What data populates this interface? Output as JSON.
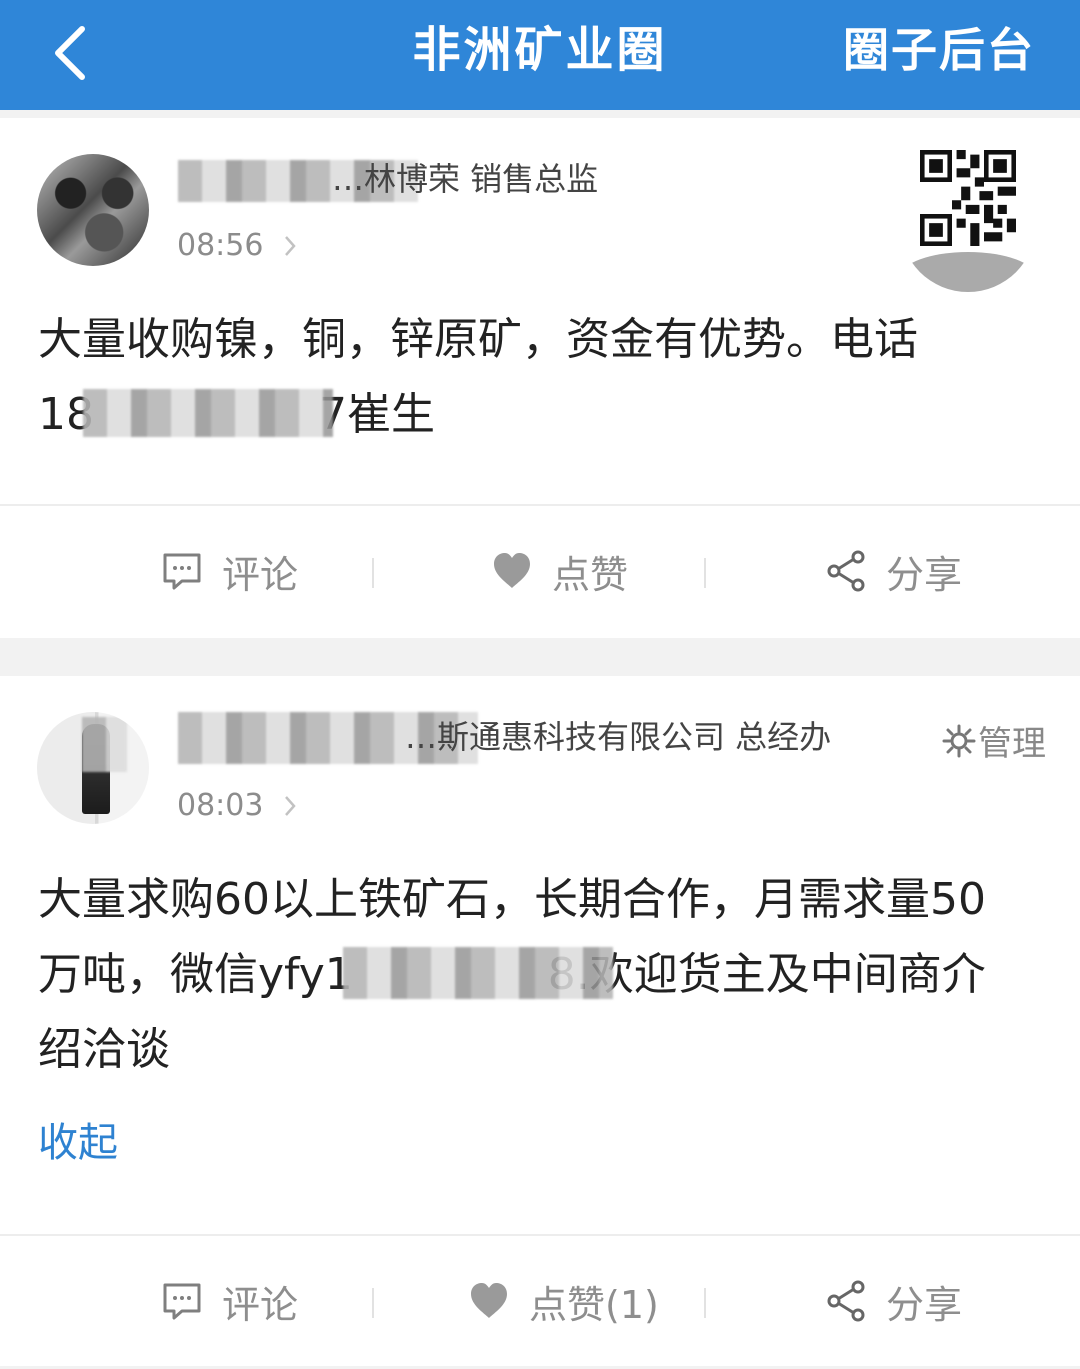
{
  "header": {
    "title": "非洲矿业圈",
    "admin": "圈子后台"
  },
  "posts": [
    {
      "name_visible": "…林博荣 销售总监",
      "time": "08:56",
      "content_line1": "大量收购镍，铜，锌原矿，资金有优势。电话",
      "content_line2_prefix": "18",
      "content_line2_suffix": "7崔生",
      "actions": {
        "comment": "评论",
        "like": "点赞",
        "share": "分享"
      }
    },
    {
      "name_visible": "…斯通惠科技有限公司 总经办",
      "manage": "管理",
      "time": "08:03",
      "content_line1": "大量求购60以上铁矿石，长期合作，月需求量50",
      "content_line2_prefix": "万吨，微信yfy1",
      "content_line2_suffix": "8.欢迎货主及中间商介",
      "content_line3": "绍洽谈",
      "collapse": "收起",
      "actions": {
        "comment": "评论",
        "like": "点赞(1)",
        "share": "分享"
      }
    }
  ],
  "icons": {
    "back": "chevron-left-icon",
    "comment": "comment-icon",
    "like": "heart-icon",
    "share": "share-icon",
    "settings": "gear-icon"
  },
  "colors": {
    "header": "#2f86d8",
    "link": "#2e82d1",
    "muted": "#8e8e8e"
  }
}
